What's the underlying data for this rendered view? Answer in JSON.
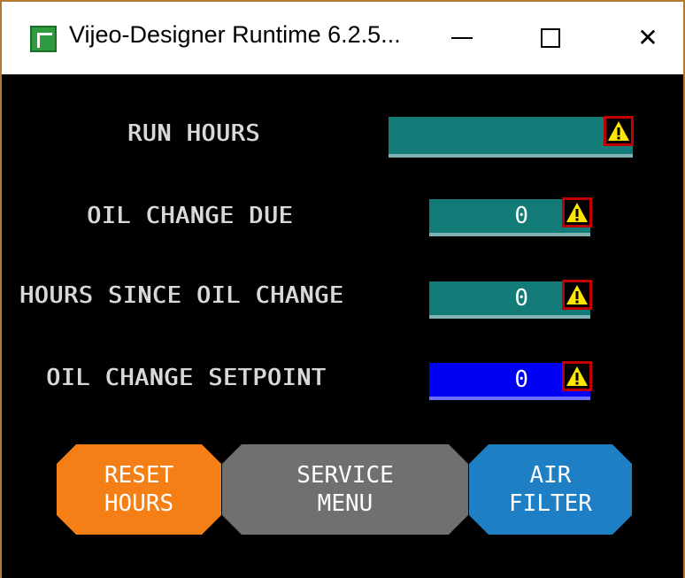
{
  "window": {
    "title": "Vijeo-Designer Runtime 6.2.5...",
    "controls": {
      "minimize": "—",
      "maximize": "□",
      "close": "✕"
    },
    "icon": "vijeo-app-icon"
  },
  "fields": [
    {
      "label": "RUN HOURS",
      "value": "",
      "style": "teal",
      "warning_icon": "warning-triangle-icon"
    },
    {
      "label": "OIL CHANGE DUE",
      "value": "0",
      "style": "teal",
      "warning_icon": "warning-triangle-icon"
    },
    {
      "label": "HOURS SINCE OIL CHANGE",
      "value": "0",
      "style": "teal",
      "warning_icon": "warning-triangle-icon"
    },
    {
      "label": "OIL CHANGE SETPOINT",
      "value": "0",
      "style": "blue",
      "warning_icon": "warning-triangle-icon"
    }
  ],
  "buttons": {
    "reset": {
      "line1": "RESET",
      "line2": "HOURS",
      "color": "#f57f17"
    },
    "service": {
      "line1": "SERVICE",
      "line2": "MENU",
      "color": "#6f716e"
    },
    "air": {
      "line1": "AIR",
      "line2": "FILTER",
      "color": "#1e7fc4"
    }
  },
  "colors": {
    "teal": "#137b77",
    "blue": "#0000f5",
    "background": "#000000",
    "frame": "#b27a2c",
    "warning": "#ffe600"
  }
}
